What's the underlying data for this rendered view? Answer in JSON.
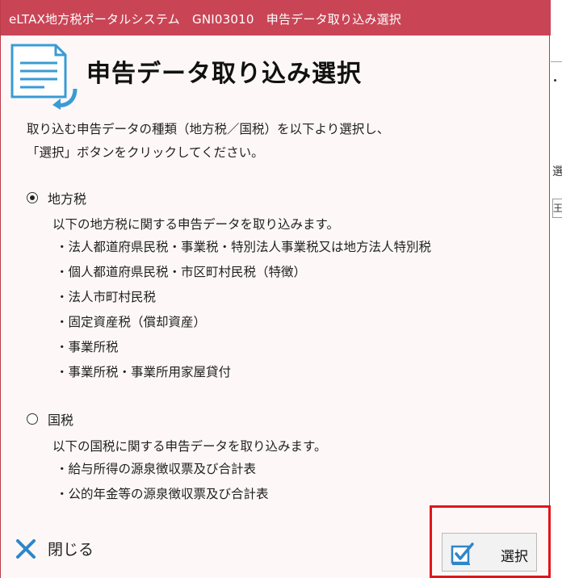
{
  "window": {
    "title": "eLTAX地方税ポータルシステム　GNI03010　申告データ取り込み選択"
  },
  "heading": "申告データ取り込み選択",
  "instructions": [
    "取り込む申告データの種類（地方税／国税）を以下より選択し、",
    "「選択」ボタンをクリックしてください。"
  ],
  "options": [
    {
      "label": "地方税",
      "checked": true,
      "description": "以下の地方税に関する申告データを取り込みます。",
      "items": [
        "・法人都道府県民税・事業税・特別法人事業税又は地方法人特別税",
        "・個人都道府県民税・市区町村民税（特徴）",
        "・法人市町村民税",
        "・固定資産税（償却資産）",
        "・事業所税",
        "・事業所税・事業所用家屋貸付"
      ]
    },
    {
      "label": "国税",
      "checked": false,
      "description": "以下の国税に関する申告データを取り込みます。",
      "items": [
        "・給与所得の源泉徴収票及び合計表",
        "・公的年金等の源泉徴収票及び合計表"
      ]
    }
  ],
  "buttons": {
    "close_label": "閉じる",
    "select_label": "選択"
  },
  "background_app": {
    "char1": "選",
    "char2": "王"
  },
  "colors": {
    "titlebar": "#c94556",
    "dialog_bg": "#fdf8f7",
    "highlight": "#e0151b",
    "icon_blue": "#3a9bd5"
  }
}
